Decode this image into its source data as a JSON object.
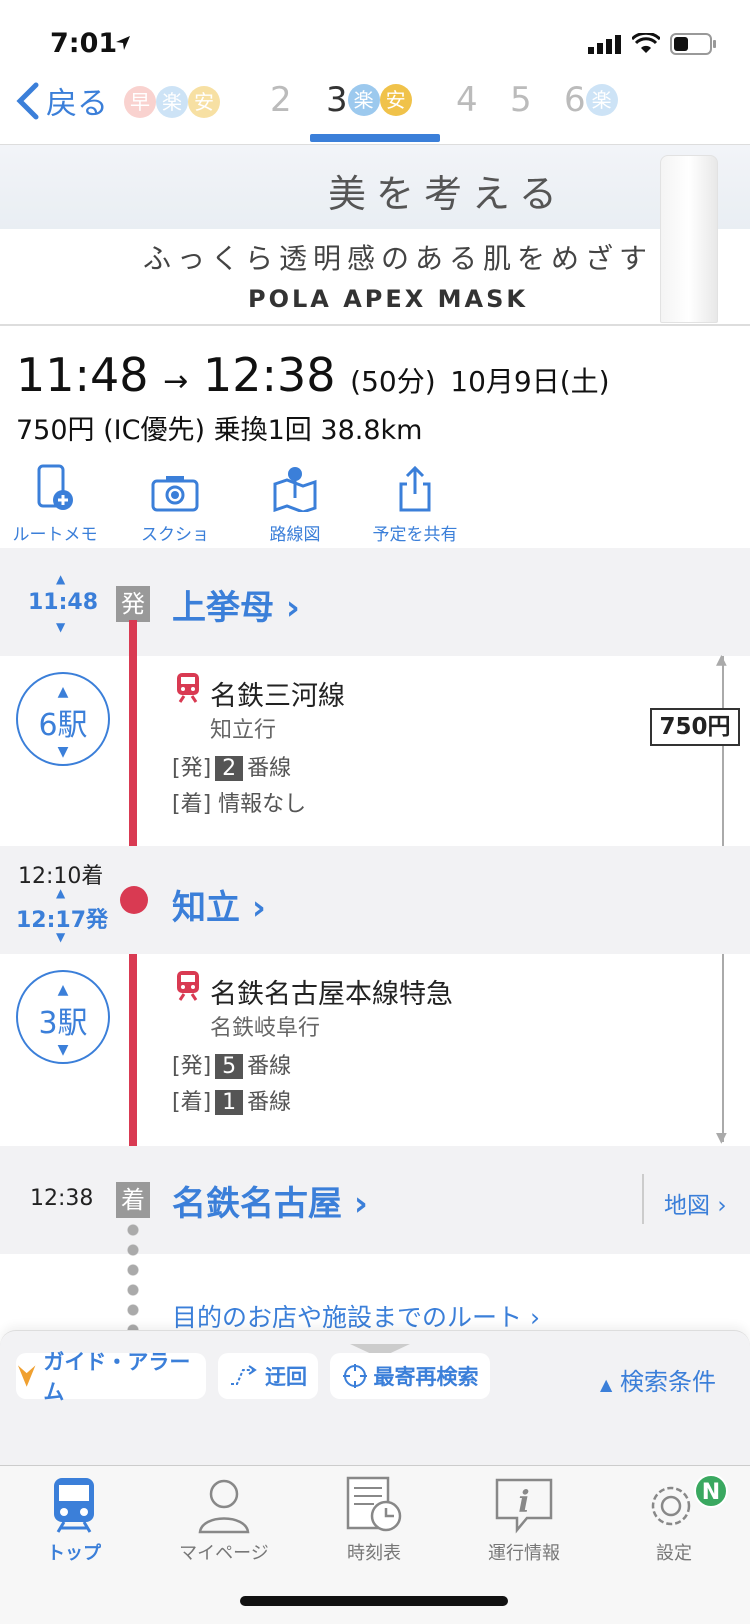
{
  "status": {
    "time": "7:01"
  },
  "tabs": {
    "back_label": "戻る",
    "routes": [
      {
        "num": "",
        "badges": [
          "早",
          "楽",
          "安"
        ]
      },
      {
        "num": "2",
        "badges": []
      },
      {
        "num": "3",
        "badges": [
          "楽",
          "安"
        ]
      },
      {
        "num": "4",
        "badges": []
      },
      {
        "num": "5",
        "badges": []
      },
      {
        "num": "6",
        "badges": [
          "楽"
        ]
      }
    ],
    "active_index": 2
  },
  "ad": {
    "line1": "美を考える",
    "line2": "ふっくら透明感のある肌をめざす",
    "line3": "POLA APEX MASK"
  },
  "summary": {
    "depart": "11:48",
    "arrive": "12:38",
    "duration": "(50分)",
    "date": "10月9日(土)",
    "fare": "750円",
    "fare_note": "(IC優先)",
    "transfers": "乗換1回",
    "distance": "38.8km"
  },
  "actions": {
    "memo": "ルートメモ",
    "screenshot": "スクショ",
    "route_map": "路線図",
    "share": "予定を共有"
  },
  "timeline": {
    "origin": {
      "time": "11:48",
      "badge": "発",
      "name": "上挙母"
    },
    "leg1": {
      "stops": "6駅",
      "line": "名鉄三河線",
      "dest": "知立行",
      "dep_label": "[発]",
      "dep_platform": "2",
      "platform_suffix": "番線",
      "arr_label": "[着]",
      "arr_info": "情報なし"
    },
    "transfer": {
      "arr_time": "12:10着",
      "dep_time": "12:17発",
      "name": "知立"
    },
    "leg2": {
      "stops": "3駅",
      "line": "名鉄名古屋本線特急",
      "dest": "名鉄岐阜行",
      "dep_label": "[発]",
      "dep_platform": "5",
      "arr_label": "[着]",
      "arr_platform": "1",
      "platform_suffix": "番線"
    },
    "fare_label": "750円",
    "destination": {
      "time": "12:38",
      "badge": "着",
      "name": "名鉄名古屋",
      "map_label": "地図"
    },
    "walk_link": "目的のお店や施設までのルート"
  },
  "bottom_actions": {
    "guide": "ガイド・アラーム",
    "detour": "迂回",
    "nearest": "最寄再検索",
    "conditions": "検索条件"
  },
  "tabbar": {
    "items": [
      "トップ",
      "マイページ",
      "時刻表",
      "運行情報",
      "設定"
    ],
    "active_index": 0,
    "settings_badge": "N"
  },
  "colors": {
    "accent": "#3b7fd9",
    "line_red": "#d93a52",
    "badge_haya": "#f4a6a0",
    "badge_raku": "#9cc9ee",
    "badge_yasu": "#f0c24a"
  }
}
